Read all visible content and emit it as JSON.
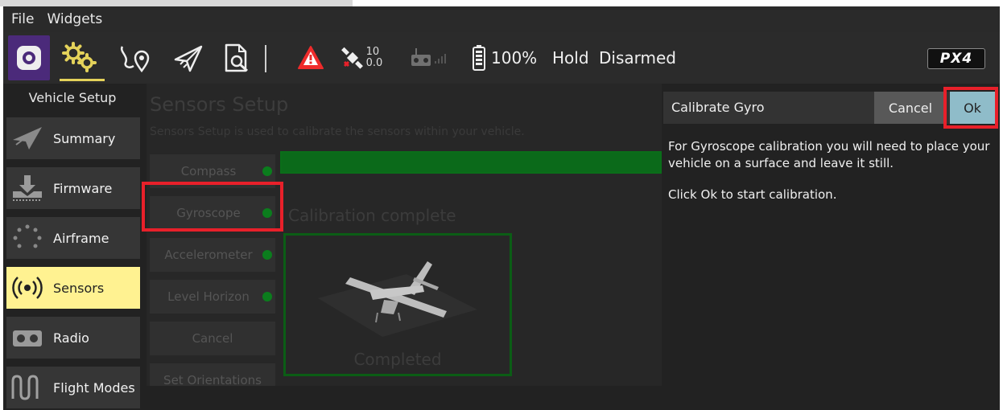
{
  "menubar": {
    "file": "File",
    "widgets": "Widgets"
  },
  "toolbar": {
    "gps_count": "10",
    "gps_hdop": "0.0",
    "battery": "100%",
    "flight_mode": "Hold",
    "arm_state": "Disarmed",
    "brand_logo": "PX4"
  },
  "sidebar": {
    "title": "Vehicle Setup",
    "items": [
      {
        "label": "Summary",
        "icon": "paper-plane-icon"
      },
      {
        "label": "Firmware",
        "icon": "download-icon"
      },
      {
        "label": "Airframe",
        "icon": "airframe-icon"
      },
      {
        "label": "Sensors",
        "icon": "sensors-icon"
      },
      {
        "label": "Radio",
        "icon": "radio-icon"
      },
      {
        "label": "Flight Modes",
        "icon": "flight-modes-icon"
      }
    ]
  },
  "sensors": {
    "title": "Sensors Setup",
    "description": "Sensors Setup is used to calibrate the sensors within your vehicle.",
    "buttons": [
      {
        "label": "Compass",
        "has_dot": true
      },
      {
        "label": "Gyroscope",
        "has_dot": true
      },
      {
        "label": "Accelerometer",
        "has_dot": true
      },
      {
        "label": "Level Horizon",
        "has_dot": true
      },
      {
        "label": "Cancel",
        "has_dot": false
      },
      {
        "label": "Set Orientations",
        "has_dot": false
      }
    ],
    "progress": 1.0,
    "calibration_status": "Calibration complete",
    "completed_label": "Completed"
  },
  "dialog": {
    "title": "Calibrate Gyro",
    "cancel": "Cancel",
    "ok": "Ok",
    "body_1": "For Gyroscope calibration you will need to place your vehicle on a surface and leave it still.",
    "body_2": "Click Ok to start calibration."
  },
  "colors": {
    "accent_yellow": "#fff291",
    "highlight_red": "#e8202a",
    "status_green": "#0b7d1d",
    "ok_blue": "#8fbcc9",
    "qgc_purple": "#4b2a7a"
  }
}
